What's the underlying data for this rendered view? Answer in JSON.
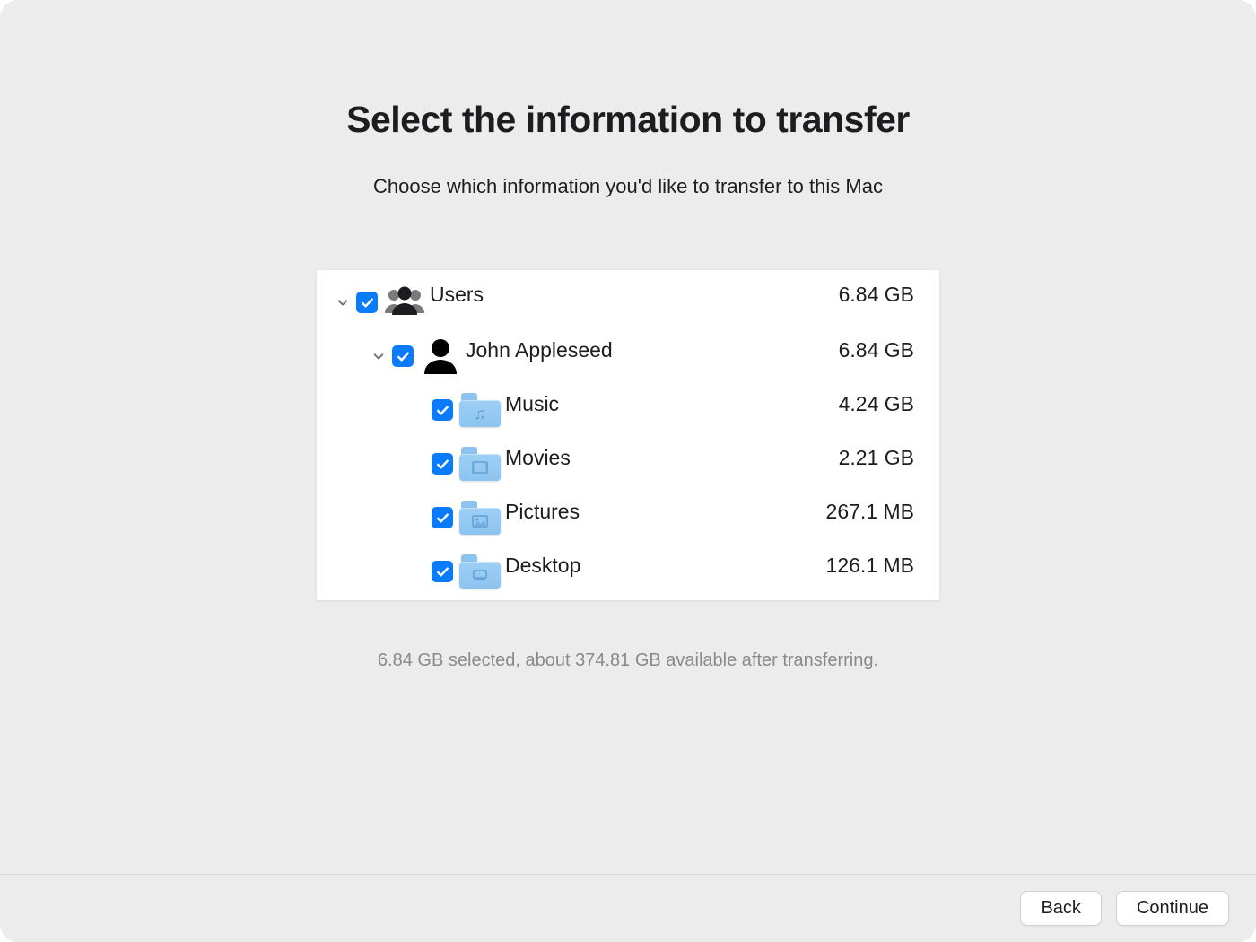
{
  "header": {
    "title": "Select the information to transfer",
    "subtitle": "Choose which information you'd like to transfer to this Mac"
  },
  "tree": {
    "users": {
      "label": "Users",
      "size": "6.84 GB",
      "user": {
        "label": "John Appleseed",
        "size": "6.84 GB",
        "folders": [
          {
            "label": "Music",
            "size": "4.24 GB",
            "icon": "music"
          },
          {
            "label": "Movies",
            "size": "2.21 GB",
            "icon": "movies"
          },
          {
            "label": "Pictures",
            "size": "267.1 MB",
            "icon": "pictures"
          },
          {
            "label": "Desktop",
            "size": "126.1 MB",
            "icon": "desktop"
          }
        ]
      }
    }
  },
  "summary": "6.84 GB selected, about 374.81 GB available after transferring.",
  "footer": {
    "back": "Back",
    "continue": "Continue"
  },
  "colors": {
    "accent": "#0a7aff",
    "folder_light": "#9ecff5",
    "folder_dark": "#8cc4ef"
  }
}
